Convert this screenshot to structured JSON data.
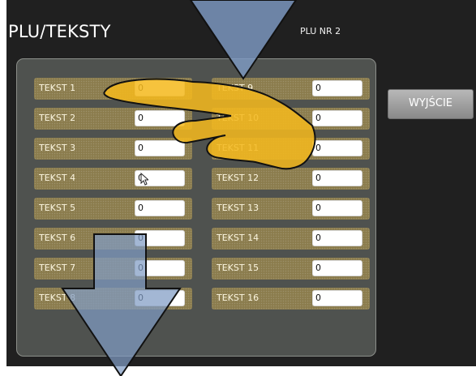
{
  "screen": {
    "title": "PLU/TEKSTY",
    "plu_number": "PLU NR 2"
  },
  "fields": [
    {
      "label": "TEKST 1",
      "value": "0"
    },
    {
      "label": "TEKST 2",
      "value": "0"
    },
    {
      "label": "TEKST 3",
      "value": "0"
    },
    {
      "label": "TEKST 4",
      "value": "0"
    },
    {
      "label": "TEKST 5",
      "value": "0"
    },
    {
      "label": "TEKST 6",
      "value": "0"
    },
    {
      "label": "TEKST 7",
      "value": "0"
    },
    {
      "label": "TEKST 8",
      "value": "0"
    },
    {
      "label": "TEKST 9",
      "value": "0"
    },
    {
      "label": "TEKST 10",
      "value": "0"
    },
    {
      "label": "TEKST 11",
      "value": "0"
    },
    {
      "label": "TEKST 12",
      "value": "0"
    },
    {
      "label": "TEKST 13",
      "value": "0"
    },
    {
      "label": "TEKST 14",
      "value": "0"
    },
    {
      "label": "TEKST 15",
      "value": "0"
    },
    {
      "label": "TEKST 16",
      "value": "0"
    }
  ],
  "exit_button": {
    "label": "WYJŚCIE"
  },
  "icons": {
    "tap_hand": "pointing-hand-icon",
    "scroll_arrow_down": "down-arrow-icon",
    "mouse_cursor": "cursor-icon"
  },
  "colors": {
    "screen_background": "#202020",
    "panel_background": "#4f524f",
    "row_background": "#8b7c4d",
    "hand_highlight": "#f4b91d",
    "arrow_highlight": "#7f9bc4"
  }
}
